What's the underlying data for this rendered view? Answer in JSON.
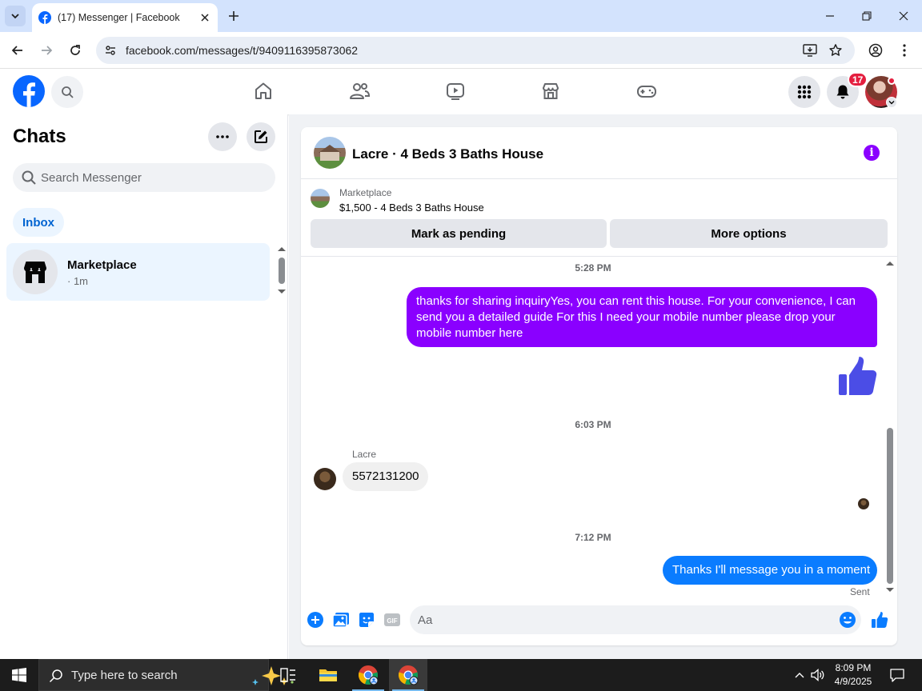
{
  "browser": {
    "tab_title": "(17) Messenger | Facebook",
    "url": "facebook.com/messages/t/9409116395873062"
  },
  "fbnav": {
    "notification_count": "17"
  },
  "sidebar": {
    "title": "Chats",
    "search_placeholder": "Search Messenger",
    "filter_label": "Inbox",
    "conversations": [
      {
        "name": "Marketplace",
        "meta": "· 1m"
      }
    ]
  },
  "conversation": {
    "title": "Lacre · 4 Beds 3 Baths House",
    "listing": {
      "source": "Marketplace",
      "detail": "$1,500 - 4 Beds 3 Baths House"
    },
    "actions": {
      "mark_pending": "Mark as pending",
      "more_options": "More options"
    },
    "messages": {
      "ts1": "5:28 PM",
      "msg1": "thanks for sharing inquiryYes, you can rent this house. For your convenience, I can send you a detailed guide For this I need your mobile number please drop your mobile number here",
      "ts2": "6:03 PM",
      "sender": "Lacre",
      "msg2": "5572131200",
      "ts3": "7:12 PM",
      "msg3": "Thanks I'll message you in a moment",
      "status": "Sent"
    },
    "composer": {
      "placeholder": "Aa"
    },
    "colors": {
      "accent_purple": "#8a00ff",
      "messenger_blue": "#0a7cff",
      "facebook_blue": "#0866ff",
      "like_blue": "#4b4de6"
    }
  },
  "taskbar": {
    "search_placeholder": "Type here to search",
    "time": "8:09 PM",
    "date": "4/9/2025"
  }
}
